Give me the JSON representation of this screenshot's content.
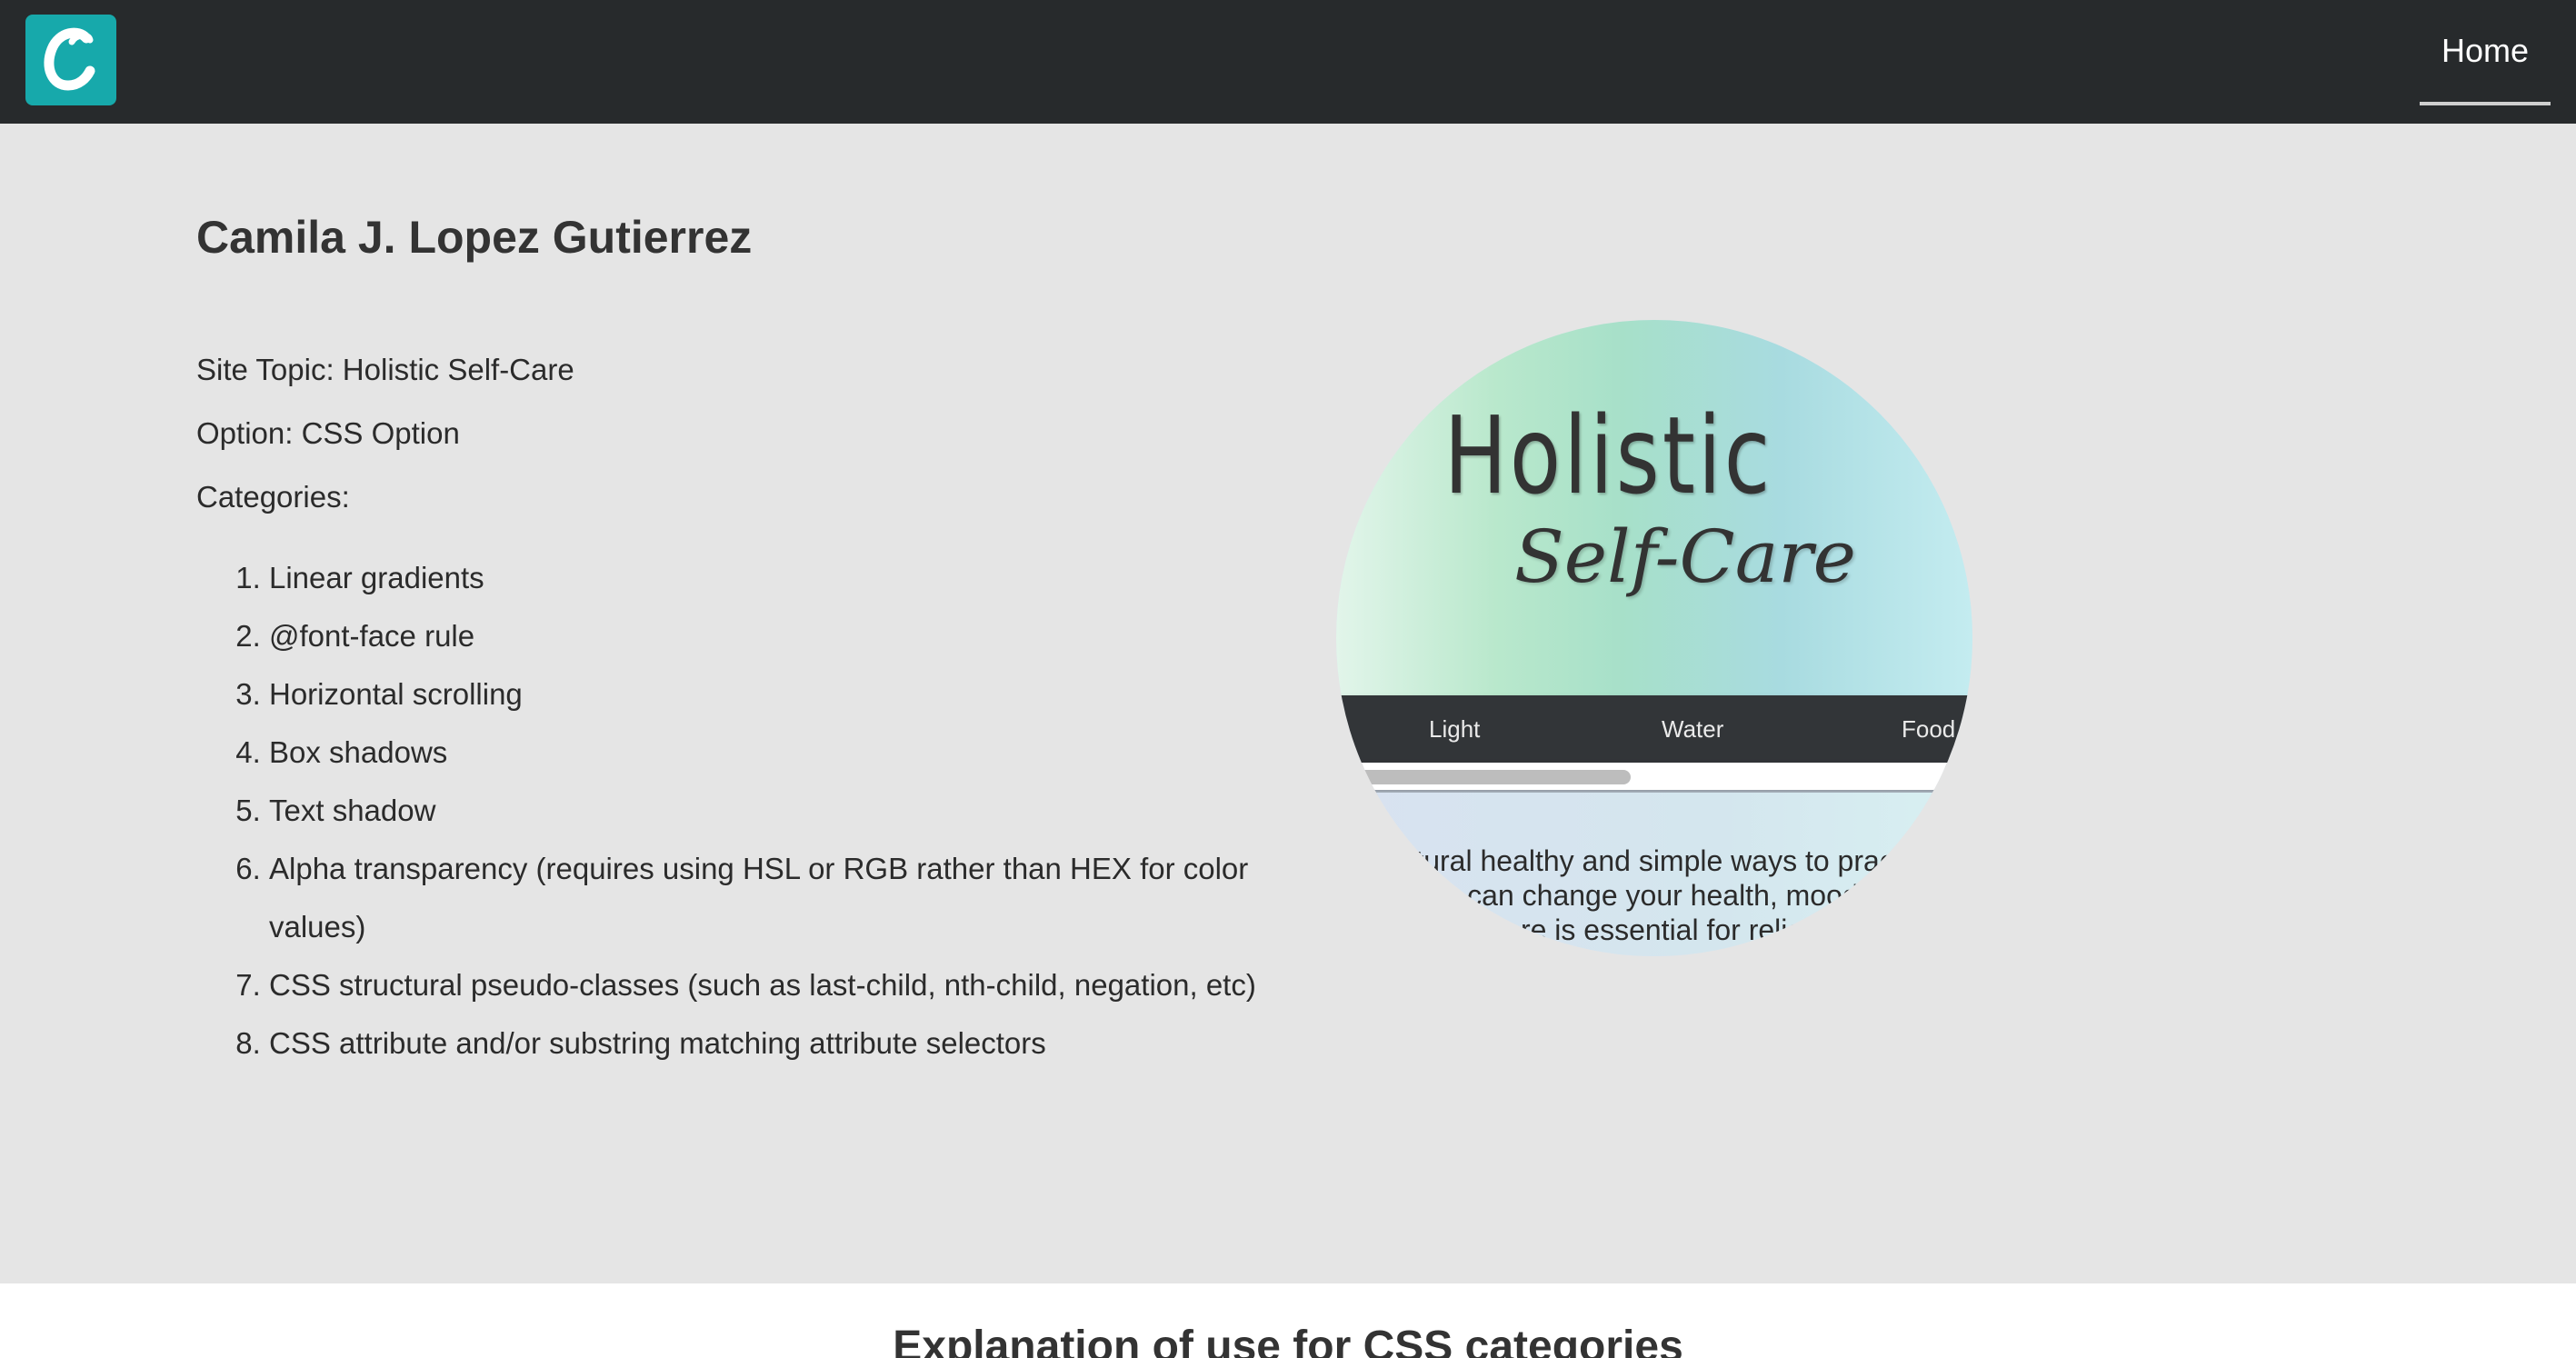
{
  "nav": {
    "logo_letter": "C",
    "logo_color": "#17a9ab",
    "home_label": "Home"
  },
  "main": {
    "author": "Camila J. Lopez Gutierrez",
    "site_topic": "Site Topic: Holistic Self-Care",
    "option": "Option: CSS Option",
    "categories_label": "Categories:",
    "categories": [
      "Linear gradients",
      "@font-face rule",
      "Horizontal scrolling",
      "Box shadows",
      "Text shadow",
      "Alpha transparency (requires using HSL or RGB rather than HEX for color values)",
      "CSS structural pseudo-classes (such as last-child, nth-child, negation, etc)",
      "CSS attribute and/or substring matching attribute selectors"
    ]
  },
  "preview": {
    "title": "Holistic",
    "subtitle": "Self-Care",
    "nav_items": [
      "Light",
      "Water",
      "Food"
    ],
    "body_text": "Natural healthy and simple ways to practice care can change your health, mood and Self-care is essential for relieving st"
  },
  "bottom": {
    "heading": "Explanation of use for CSS categories"
  }
}
